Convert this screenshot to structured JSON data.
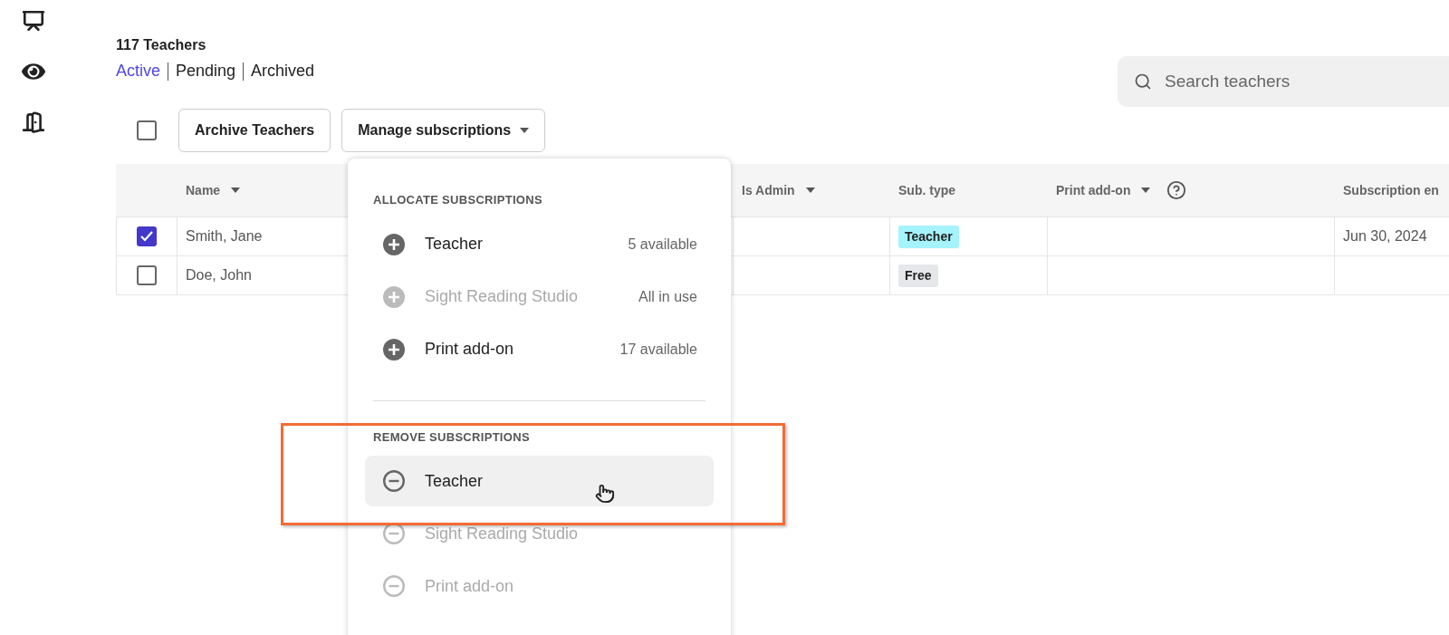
{
  "header": {
    "title": "117 Teachers",
    "tabs": [
      {
        "label": "Active",
        "selected": true
      },
      {
        "label": "Pending",
        "selected": false
      },
      {
        "label": "Archived",
        "selected": false
      }
    ]
  },
  "search": {
    "placeholder": "Search teachers"
  },
  "toolbar": {
    "select_all": {
      "checked": false
    },
    "buttons": [
      {
        "label": "Archive Teachers",
        "kind": "plain"
      },
      {
        "label": "Manage subscriptions",
        "kind": "dropdown"
      }
    ]
  },
  "table": {
    "columns": [
      {
        "label": "Name",
        "sortable": true
      },
      {
        "label": "Is Admin",
        "sortable": true
      },
      {
        "label": "Sub. type",
        "sortable": false
      },
      {
        "label": "Print add-on",
        "sortable": true,
        "help": true
      },
      {
        "label": "Subscription en"
      }
    ],
    "rows": [
      {
        "checked": true,
        "name": "Smith, Jane",
        "sub_type": {
          "label": "Teacher",
          "color": "#a5f3fc"
        },
        "subscription_end": "Jun 30, 2024"
      },
      {
        "checked": false,
        "name": "Doe, John",
        "sub_type": {
          "label": "Free",
          "color": "#e5e7eb"
        }
      }
    ]
  },
  "menu": {
    "sections": [
      {
        "heading": "ALLOCATE SUBSCRIPTIONS",
        "kind": "add",
        "items": [
          {
            "label": "Teacher",
            "note": "5 available",
            "disabled": false,
            "selected": false
          },
          {
            "label": "Sight Reading Studio",
            "note": "All in use",
            "disabled": true,
            "selected": false
          },
          {
            "label": "Print add-on",
            "note": "17 available",
            "disabled": false,
            "selected": false
          }
        ]
      },
      {
        "heading": "REMOVE SUBSCRIPTIONS",
        "kind": "remove",
        "items": [
          {
            "label": "Teacher",
            "disabled": false,
            "selected": true
          },
          {
            "label": "Sight Reading Studio",
            "disabled": true,
            "selected": false
          },
          {
            "label": "Print add-on",
            "disabled": true,
            "selected": false
          }
        ]
      }
    ]
  }
}
